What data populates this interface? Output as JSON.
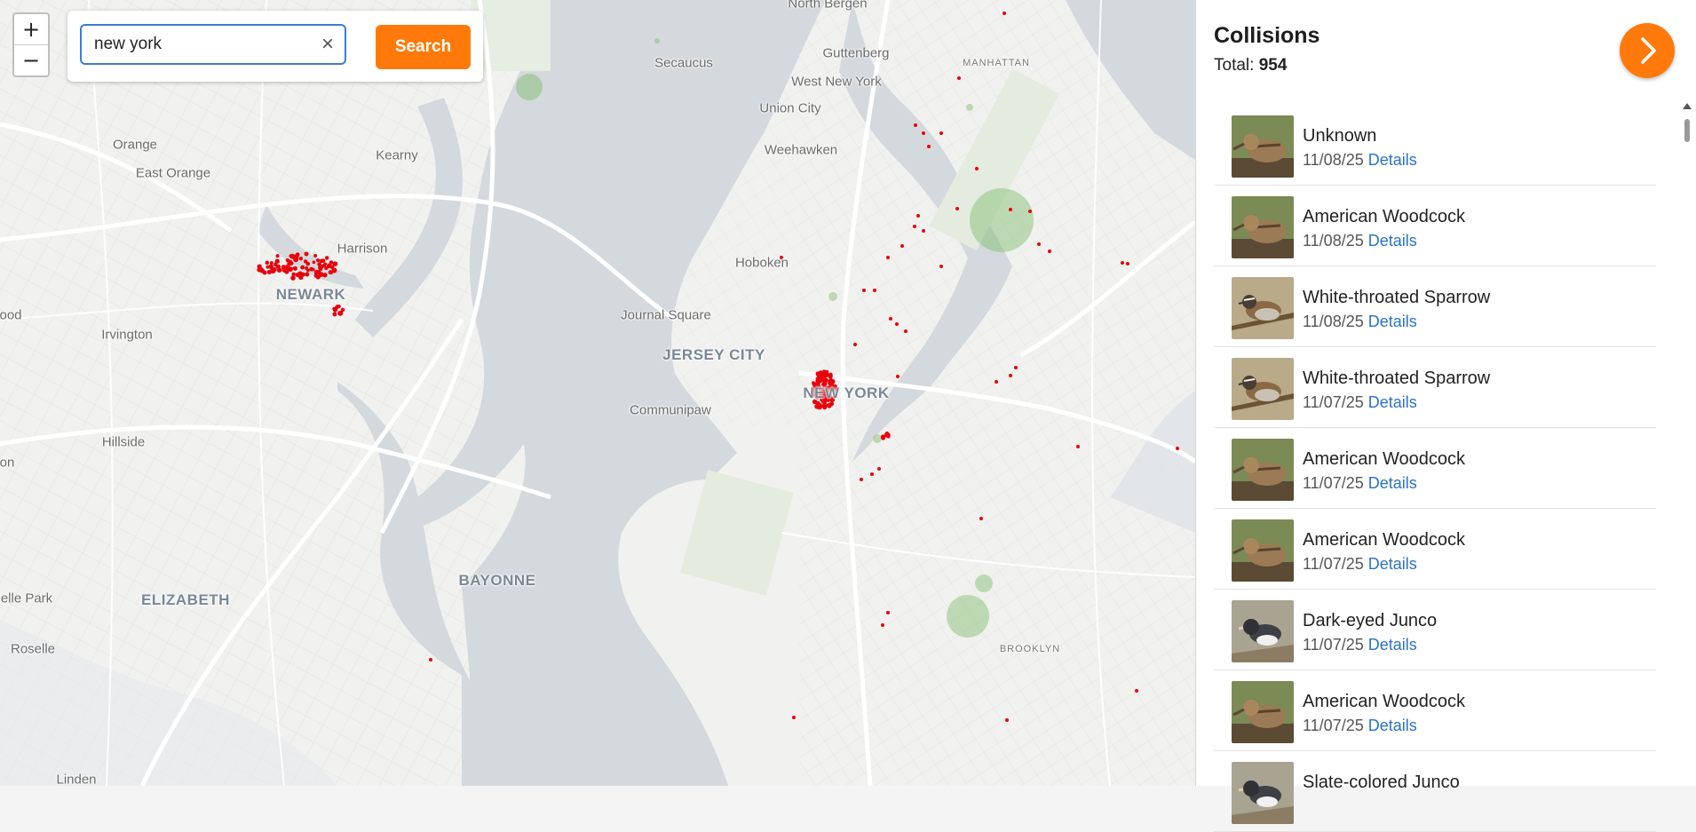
{
  "search": {
    "value": "new york",
    "button_label": "Search",
    "clear_icon": "×"
  },
  "zoom": {
    "in_label": "+",
    "out_label": "−"
  },
  "map": {
    "places": [
      {
        "name": "North Bergen",
        "cls": ""
      },
      {
        "name": "Secaucus",
        "cls": ""
      },
      {
        "name": "Guttenberg",
        "cls": ""
      },
      {
        "name": "West New York",
        "cls": ""
      },
      {
        "name": "Union City",
        "cls": ""
      },
      {
        "name": "Weehawken",
        "cls": ""
      },
      {
        "name": "MANHATTAN",
        "cls": "district"
      },
      {
        "name": "Orange",
        "cls": ""
      },
      {
        "name": "East Orange",
        "cls": ""
      },
      {
        "name": "Kearny",
        "cls": ""
      },
      {
        "name": "Harrison",
        "cls": ""
      },
      {
        "name": "NEWARK",
        "cls": "major"
      },
      {
        "name": "Hoboken",
        "cls": ""
      },
      {
        "name": "Journal Square",
        "cls": ""
      },
      {
        "name": "JERSEY CITY",
        "cls": "major"
      },
      {
        "name": "NEW YORK",
        "cls": "major"
      },
      {
        "name": "Communipaw",
        "cls": ""
      },
      {
        "name": "ood",
        "cls": ""
      },
      {
        "name": "Irvington",
        "cls": ""
      },
      {
        "name": "Hillside",
        "cls": ""
      },
      {
        "name": "on",
        "cls": ""
      },
      {
        "name": "BAYONNE",
        "cls": "major"
      },
      {
        "name": "ELIZABETH",
        "cls": "major"
      },
      {
        "name": "elle Park",
        "cls": ""
      },
      {
        "name": "Roselle",
        "cls": ""
      },
      {
        "name": "BROOKLYN",
        "cls": "district"
      },
      {
        "name": "Linden",
        "cls": ""
      }
    ]
  },
  "panel": {
    "title": "Collisions",
    "total_label": "Total:",
    "total_value": "954",
    "details_label": "Details",
    "items": [
      {
        "name": "Unknown",
        "date": "11/08/25",
        "bird": "woodcock"
      },
      {
        "name": "American Woodcock",
        "date": "11/08/25",
        "bird": "woodcock"
      },
      {
        "name": "White-throated Sparrow",
        "date": "11/08/25",
        "bird": "sparrow"
      },
      {
        "name": "White-throated Sparrow",
        "date": "11/07/25",
        "bird": "sparrow"
      },
      {
        "name": "American Woodcock",
        "date": "11/07/25",
        "bird": "woodcock"
      },
      {
        "name": "American Woodcock",
        "date": "11/07/25",
        "bird": "woodcock"
      },
      {
        "name": "Dark-eyed Junco",
        "date": "11/07/25",
        "bird": "junco"
      },
      {
        "name": "American Woodcock",
        "date": "11/07/25",
        "bird": "woodcock"
      },
      {
        "name": "Slate-colored Junco",
        "date": "",
        "bird": "junco"
      }
    ]
  },
  "colors": {
    "accent": "#ff7a0a",
    "link": "#2a72c9",
    "marker": "#e8000a",
    "water": "#d4d9dd",
    "park": "#b7d7ad"
  }
}
